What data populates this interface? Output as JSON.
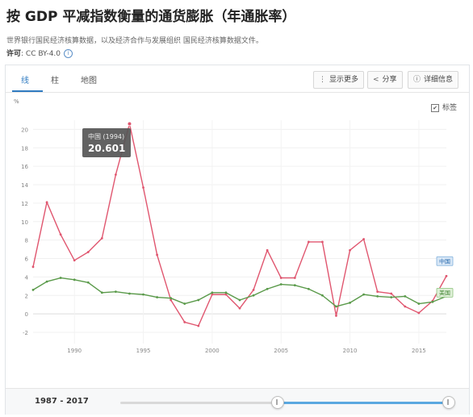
{
  "page": {
    "title": "按 GDP 平减指数衡量的通货膨胀（年通胀率）",
    "subtitle": "世界银行国民经济核算数据，以及经济合作与发展组织 国民经济核算数据文件。",
    "license_label": "许可",
    "license_value": ": CC BY-4.0",
    "info_icon": "info-icon"
  },
  "tabs": [
    {
      "label": "线",
      "active": true
    },
    {
      "label": "柱",
      "active": false
    },
    {
      "label": "地图",
      "active": false
    }
  ],
  "toolbar": {
    "show_more": "显示更多",
    "share": "分享",
    "details": "详细信息"
  },
  "legend": {
    "checkbox_label": "标签",
    "checked": true
  },
  "tooltip": {
    "label": "中国 (1994)",
    "value": "20.601"
  },
  "footer": {
    "range_label": "1987 - 2017",
    "slider_start_fraction": 0.0,
    "slider_end_fraction": 1.0
  },
  "colors": {
    "china": "#e0566f",
    "usa": "#5a9a4a",
    "accent": "#2f7bc1"
  },
  "chart_data": {
    "type": "line",
    "ylabel": "%",
    "ylim": [
      -2,
      21
    ],
    "yticks": [
      -2,
      0,
      2,
      4,
      6,
      8,
      10,
      12,
      14,
      16,
      18,
      20
    ],
    "xlim": [
      1987,
      2017
    ],
    "xticks": [
      1990,
      1995,
      2000,
      2005,
      2010,
      2015
    ],
    "x": [
      1987,
      1988,
      1989,
      1990,
      1991,
      1992,
      1993,
      1994,
      1995,
      1996,
      1997,
      1998,
      1999,
      2000,
      2001,
      2002,
      2003,
      2004,
      2005,
      2006,
      2007,
      2008,
      2009,
      2010,
      2011,
      2012,
      2013,
      2014,
      2015,
      2016,
      2017
    ],
    "series": [
      {
        "name": "中国",
        "color": "#e0566f",
        "values": [
          5.1,
          12.1,
          8.6,
          5.8,
          6.7,
          8.2,
          15.1,
          20.6,
          13.7,
          6.4,
          1.5,
          -0.9,
          -1.3,
          2.1,
          2.1,
          0.6,
          2.6,
          6.9,
          3.9,
          3.9,
          7.8,
          7.8,
          -0.2,
          6.9,
          8.1,
          2.4,
          2.2,
          0.8,
          0.1,
          1.4,
          4.1
        ]
      },
      {
        "name": "美国",
        "color": "#5a9a4a",
        "values": [
          2.6,
          3.5,
          3.9,
          3.7,
          3.4,
          2.3,
          2.4,
          2.2,
          2.1,
          1.8,
          1.7,
          1.1,
          1.5,
          2.3,
          2.3,
          1.5,
          2.0,
          2.7,
          3.2,
          3.1,
          2.7,
          2.0,
          0.8,
          1.2,
          2.1,
          1.9,
          1.8,
          1.9,
          1.1,
          1.3,
          1.9
        ]
      }
    ]
  }
}
